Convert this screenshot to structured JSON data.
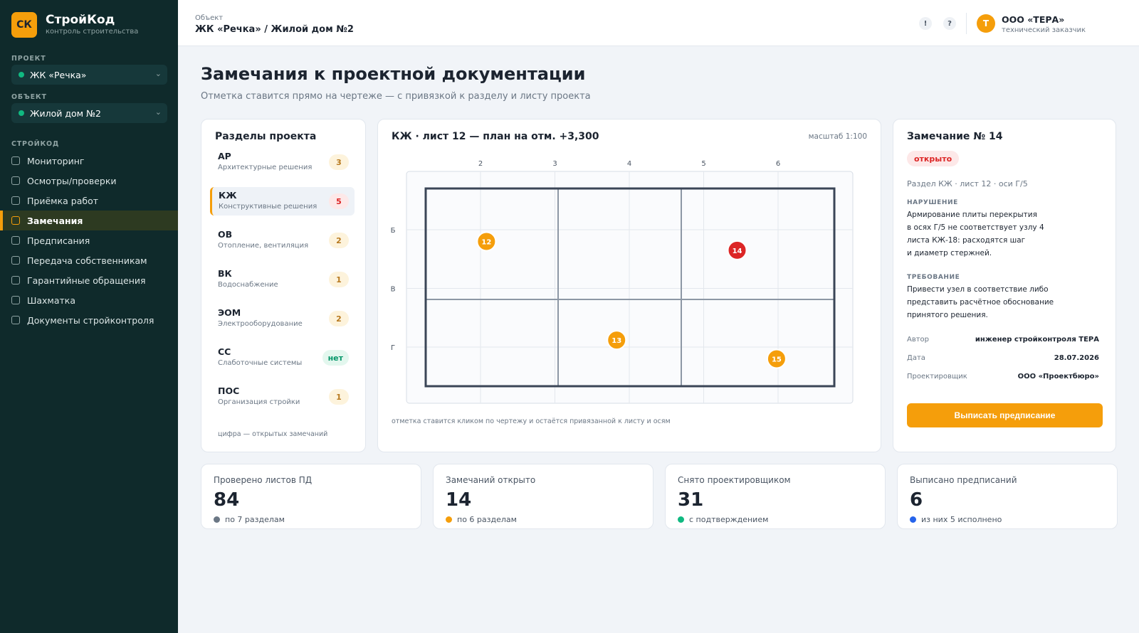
{
  "app": {
    "logo": "СК",
    "name": "СтройКод",
    "tagline": "контроль строительства"
  },
  "sidebar": {
    "project_label": "ПРОЕКТ",
    "project_value": "ЖК «Речка»",
    "object_label": "ОБЪЕКТ",
    "object_value": "Жилой дом №2",
    "section_label": "СТРОЙКОД",
    "items": [
      {
        "label": "Мониторинг"
      },
      {
        "label": "Осмотры/проверки"
      },
      {
        "label": "Приёмка работ"
      },
      {
        "label": "Замечания"
      },
      {
        "label": "Предписания"
      },
      {
        "label": "Передача собственникам"
      },
      {
        "label": "Гарантийные обращения"
      },
      {
        "label": "Шахматка"
      },
      {
        "label": "Документы стройконтроля"
      }
    ],
    "active_index": 3
  },
  "topbar": {
    "crumb_label": "Объект",
    "crumb": "ЖК «Речка» / Жилой дом №2",
    "alert_icon": "!",
    "help_icon": "?",
    "avatar": "Т",
    "user_name": "ООО «ТЕРА»",
    "user_role": "технический заказчик"
  },
  "page": {
    "title": "Замечания к проектной документации",
    "subtitle": "Отметка ставится прямо на чертеже — с привязкой к разделу и листу проекта"
  },
  "sections": {
    "title": "Разделы проекта",
    "items": [
      {
        "code": "АР",
        "name": "Архитектурные решения",
        "badge": "3",
        "kind": "warn"
      },
      {
        "code": "КЖ",
        "name": "Конструктивные решения",
        "badge": "5",
        "kind": "danger"
      },
      {
        "code": "ОВ",
        "name": "Отопление, вентиляция",
        "badge": "2",
        "kind": "warn"
      },
      {
        "code": "ВК",
        "name": "Водоснабжение",
        "badge": "1",
        "kind": "warn"
      },
      {
        "code": "ЭОМ",
        "name": "Электрооборудование",
        "badge": "2",
        "kind": "warn"
      },
      {
        "code": "СС",
        "name": "Слаботочные системы",
        "badge": "нет",
        "kind": "ok"
      },
      {
        "code": "ПОС",
        "name": "Организация стройки",
        "badge": "1",
        "kind": "warn"
      }
    ],
    "active_index": 1,
    "footnote": "цифра — открытых замечаний"
  },
  "drawing": {
    "title": "КЖ · лист 12 — план на отм. +3,300",
    "scale": "масштаб 1:100",
    "axes_x": [
      "2",
      "3",
      "4",
      "5",
      "6"
    ],
    "axes_y": [
      "Б",
      "В",
      "Г"
    ],
    "markers": [
      {
        "label": "12",
        "status": "warn",
        "ax": 2.08,
        "ay": 1.2
      },
      {
        "label": "14",
        "status": "danger",
        "ax": 5.45,
        "ay": 1.35
      },
      {
        "label": "13",
        "status": "warn",
        "ax": 3.83,
        "ay": 2.88
      },
      {
        "label": "15",
        "status": "warn",
        "ax": 5.98,
        "ay": 3.2
      }
    ],
    "footnote": "отметка ставится кликом по чертежу и остаётся привязанной к листу и осям"
  },
  "detail": {
    "title": "Замечание № 14",
    "status": "открыто",
    "ref": "Раздел КЖ · лист 12 · оси Г/5",
    "violation_label": "НАРУШЕНИЕ",
    "violation_lines": [
      "Армирование плиты перекрытия",
      "в осях Г/5 не соответствует узлу 4",
      "листа КЖ-18: расходятся шаг",
      "и диаметр стержней."
    ],
    "requirement_label": "ТРЕБОВАНИЕ",
    "requirement_lines": [
      "Привести узел в соответствие либо",
      "представить расчётное обоснование",
      "принятого решения."
    ],
    "meta": [
      {
        "key": "Автор",
        "value": "инженер стройконтроля ТЕРА"
      },
      {
        "key": "Дата",
        "value": "28.07.2026"
      },
      {
        "key": "Проектировщик",
        "value": "ООО «Проектбюро»"
      }
    ],
    "button": "Выписать предписание"
  },
  "stats": [
    {
      "label": "Проверено листов ПД",
      "value": "84",
      "note": "по 7 разделам",
      "color": "#6b7785"
    },
    {
      "label": "Замечаний открыто",
      "value": "14",
      "note": "по 6 разделам",
      "color": "#f59e0b"
    },
    {
      "label": "Снято проектировщиком",
      "value": "31",
      "note": "с подтверждением",
      "color": "#10b981"
    },
    {
      "label": "Выписано предписаний",
      "value": "6",
      "note": "из них 5 исполнено",
      "color": "#2563eb"
    }
  ],
  "colors": {
    "accent": "#f59e0b",
    "danger": "#dc2626",
    "ok": "#10b981",
    "sidebar": "#0f2a2b"
  }
}
